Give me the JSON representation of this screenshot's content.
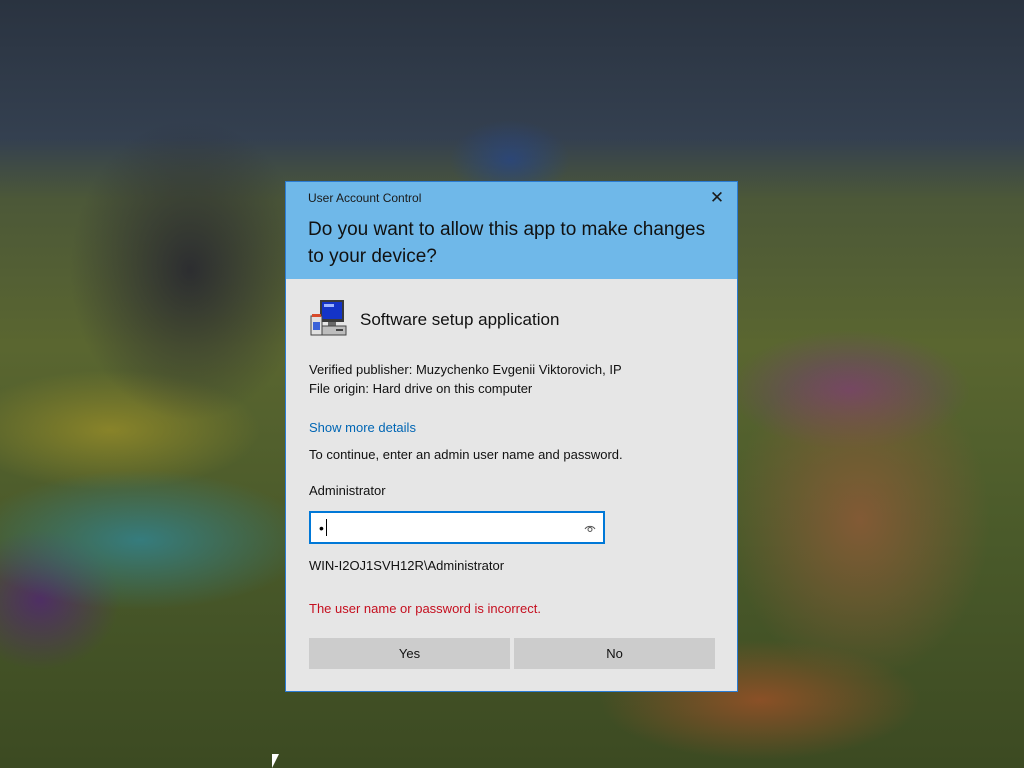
{
  "dialog": {
    "window_title": "User Account Control",
    "close_glyph": "✕",
    "question": "Do you want to allow this app to make changes to your device?",
    "app_icon": "installer-computer-icon",
    "app_name": "Software setup application",
    "publisher": "Verified publisher: Muzychenko Evgenii Viktorovich, IP",
    "file_origin": "File origin: Hard drive on this computer",
    "show_more_link": "Show more details",
    "instruction": "To continue, enter an admin user name and password.",
    "username": "Administrator",
    "password_mask": "•",
    "reveal_icon": "eye-icon",
    "domain_account": "WIN-I2OJ1SVH12R\\Administrator",
    "error_message": "The user name or password is incorrect.",
    "yes_label": "Yes",
    "no_label": "No"
  },
  "colors": {
    "header": "#6fb8e9",
    "body": "#e6e6e6",
    "link": "#0066b4",
    "error": "#c50f1f",
    "focus_border": "#0078d7",
    "button": "#cccccc"
  }
}
